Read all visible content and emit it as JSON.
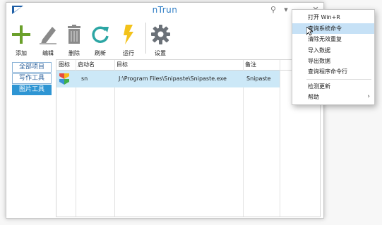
{
  "window": {
    "title": "nTrun",
    "controls": {
      "search_icon": "⚲",
      "menu_icon": "▾",
      "minimize_icon": "—",
      "close_icon": "✕"
    }
  },
  "toolbar": {
    "items": [
      {
        "label": "添加",
        "icon": "plus-icon",
        "color": "#6aa02a"
      },
      {
        "label": "编辑",
        "icon": "pencil-icon",
        "color": "#8a8a8a"
      },
      {
        "label": "删除",
        "icon": "trash-icon",
        "color": "#8a8a8a"
      },
      {
        "label": "刷新",
        "icon": "refresh-icon",
        "color": "#2ca6a4"
      },
      {
        "label": "运行",
        "icon": "lightning-icon",
        "color": "#f3c21a"
      },
      {
        "label": "设置",
        "icon": "gear-icon",
        "color": "#6b7178"
      }
    ]
  },
  "sidebar": {
    "items": [
      {
        "label": "全部项目",
        "active": false
      },
      {
        "label": "写作工具",
        "active": false
      },
      {
        "label": "图片工具",
        "active": true
      }
    ]
  },
  "table": {
    "headers": [
      "图标",
      "启动名",
      "目标",
      "备注"
    ],
    "rows": [
      {
        "icon": "snipaste-logo-icon",
        "name": "sn",
        "target": "J:\\Program Files\\Snipaste\\Snipaste.exe",
        "note": "Snipaste"
      }
    ]
  },
  "context_menu": {
    "items": [
      {
        "label": "打开 Win+R"
      },
      {
        "label": "查询系统命令",
        "highlight": true
      },
      {
        "label": "清除无效重复"
      },
      {
        "label": "导入数据"
      },
      {
        "label": "导出数据"
      },
      {
        "label": "查询程序命令行"
      },
      {
        "label": "检测更新"
      },
      {
        "label": "帮助",
        "submenu": true
      }
    ],
    "submenu_arrow": "›"
  },
  "colors": {
    "accent": "#2e95d3",
    "title": "#2b7bc4",
    "selection": "#cce8f7",
    "menu_highlight": "#c6e1f6"
  }
}
